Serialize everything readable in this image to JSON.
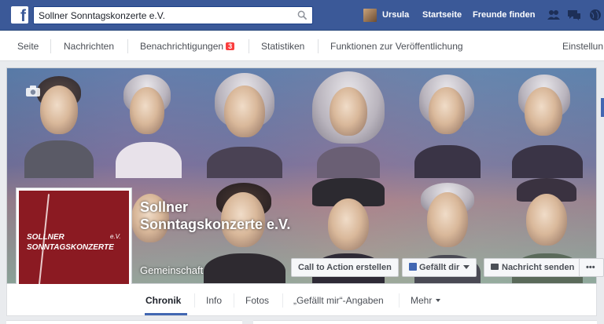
{
  "topbar": {
    "search_value": "Sollner Sonntagskonzerte e.V.",
    "user_name": "Ursula",
    "home_label": "Startseite",
    "find_friends_label": "Freunde finden"
  },
  "subnav": {
    "items": [
      "Seite",
      "Nachrichten",
      "Benachrichtigungen",
      "Statistiken",
      "Funktionen zur Veröffentlichung",
      "Einstellun"
    ],
    "notifications_count": "3"
  },
  "page": {
    "name": "Sollner Sonntagskonzerte e.V.",
    "category": "Gemeinschaft",
    "logo_line1": "SOLLNER",
    "logo_line2": "SONNTAGSKONZERTE",
    "logo_ev": "e.V."
  },
  "buttons": {
    "cta": "Call to Action erstellen",
    "like": "Gefällt dir",
    "message": "Nachricht senden",
    "more": "•••"
  },
  "tabs": [
    "Chronik",
    "Info",
    "Fotos",
    "„Gefällt mir“-Angaben",
    "Mehr"
  ],
  "colors": {
    "brand_blue": "#3b5998",
    "logo_red": "#8b1a22",
    "badge_red": "#fa3e3e"
  }
}
